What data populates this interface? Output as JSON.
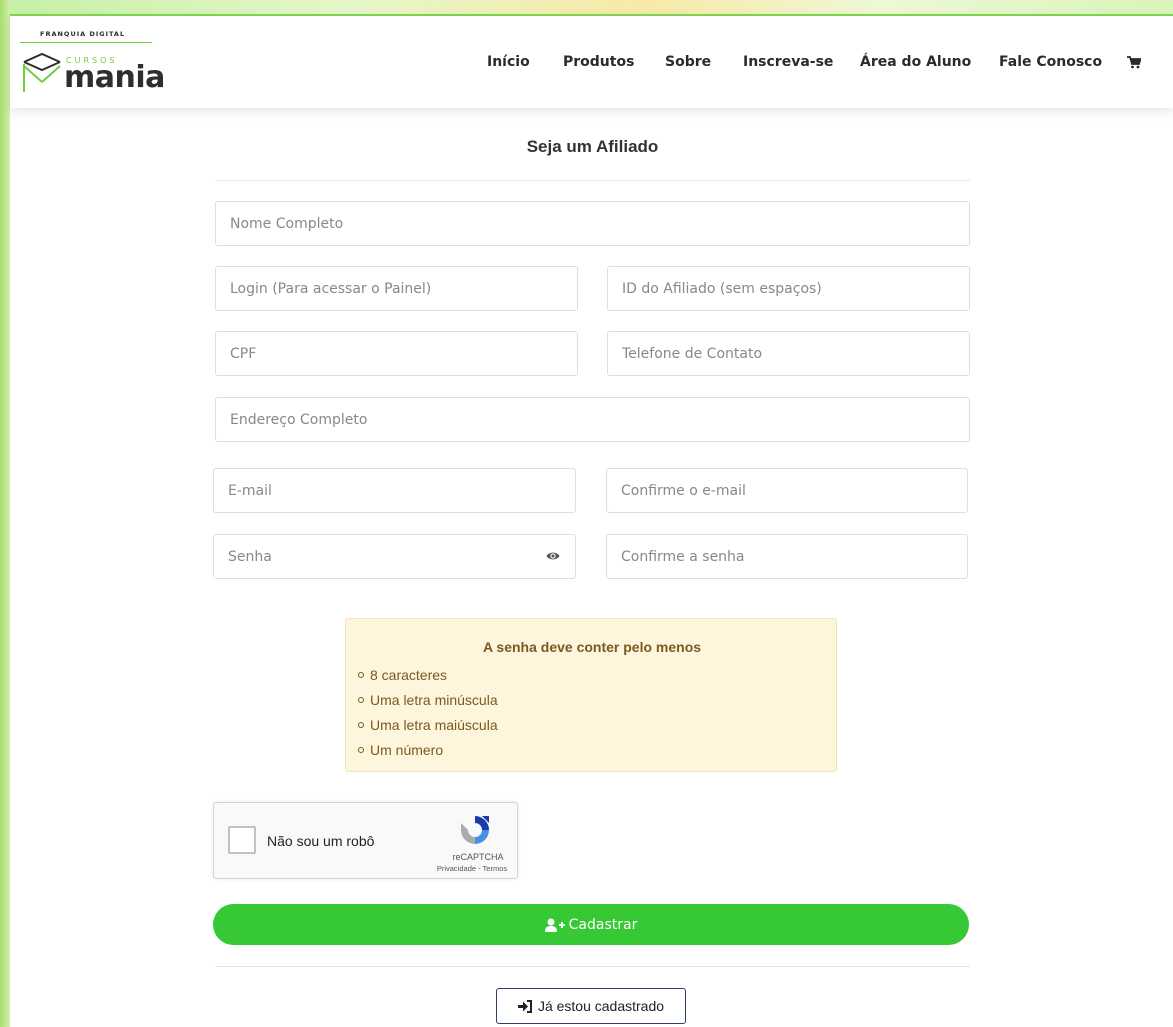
{
  "brand": {
    "tagline_prefix": "FRANQUIA",
    "tagline_bold": "DIGITAL",
    "small_word": "CURSOS",
    "name": "mania",
    "accent_color": "#6fce3c"
  },
  "nav": {
    "items": [
      "Início",
      "Produtos",
      "Sobre",
      "Inscreva-se",
      "Área do Aluno",
      "Fale Conosco"
    ],
    "cart_icon": "shopping-cart-icon"
  },
  "form": {
    "title": "Seja um Afiliado",
    "fields": {
      "full_name": "Nome Completo",
      "login": "Login (Para acessar o Painel)",
      "affiliate_id": "ID do Afiliado (sem espaços)",
      "cpf": "CPF",
      "phone": "Telefone de Contato",
      "address": "Endereço Completo",
      "email": "E-mail",
      "email_confirm": "Confirme o e-mail",
      "password": "Senha",
      "password_confirm": "Confirme a senha"
    },
    "password_rules": {
      "title": "A senha deve conter pelo menos",
      "items": [
        "8 caracteres",
        "Uma letra minúscula",
        "Uma letra maiúscula",
        "Um número"
      ],
      "bg_color": "#fdf5dc",
      "text_color": "#7a5a1e"
    },
    "captcha": {
      "label": "Não sou um robô",
      "brand": "reCAPTCHA",
      "links": "Privacidade - Termos"
    },
    "submit_label": "Cadastrar",
    "submit_color": "#36c935",
    "login_label": "Já estou cadastrado"
  }
}
